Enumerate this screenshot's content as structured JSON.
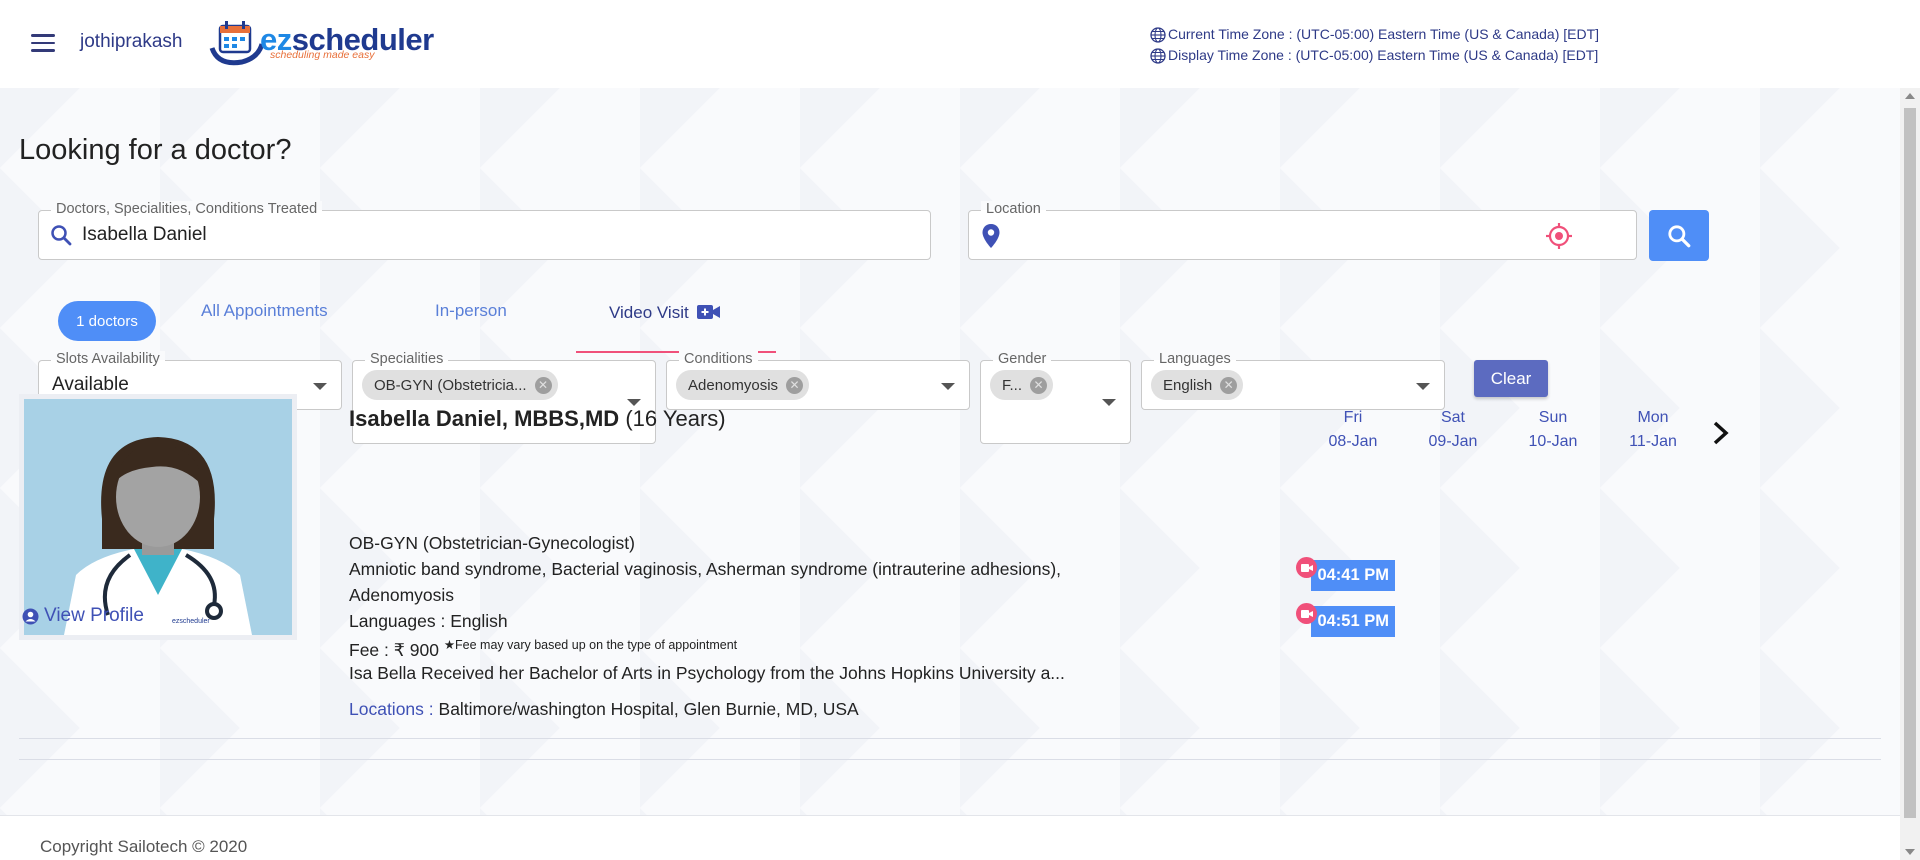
{
  "header": {
    "username": "jothiprakash",
    "logo_main": "ezscheduler",
    "logo_tagline": "scheduling made easy",
    "current_tz": "Current Time Zone : (UTC-05:00) Eastern Time (US & Canada) [EDT]",
    "display_tz": "Display Time Zone : (UTC-05:00) Eastern Time (US & Canada) [EDT]"
  },
  "page": {
    "title": "Looking for a doctor?"
  },
  "search": {
    "query_label": "Doctors, Specialities, Conditions Treated",
    "query_value": "Isabella Daniel",
    "location_label": "Location",
    "location_value": ""
  },
  "tabs": {
    "count": "1 doctors",
    "all": "All Appointments",
    "inperson": "In-person",
    "video": "Video Visit",
    "active": "video"
  },
  "filters": {
    "slots": {
      "label": "Slots Availability",
      "value": "Available"
    },
    "specialities": {
      "label": "Specialities",
      "chip": "OB-GYN (Obstetricia..."
    },
    "conditions": {
      "label": "Conditions",
      "chip": "Adenomyosis"
    },
    "gender": {
      "label": "Gender",
      "chip": "F..."
    },
    "languages": {
      "label": "Languages",
      "chip": "English"
    },
    "clear": "Clear"
  },
  "doctor": {
    "name": "Isabella Daniel, MBBS,MD",
    "experience": "(16 Years)",
    "speciality": "OB-GYN (Obstetrician-Gynecologist)",
    "conditions_line1": "Amniotic band syndrome, Bacterial vaginosis, Asherman syndrome (intrauterine adhesions),",
    "conditions_line2": "Adenomyosis",
    "languages": "Languages : English",
    "fee": "Fee : ₹ 900",
    "fee_note": "★Fee may vary based up on the type of appointment",
    "bio": "Isa Bella Received her Bachelor of Arts in Psychology from the Johns Hopkins University a...",
    "locations_label": "Locations :",
    "locations_value": "Baltimore/washington Hospital, Glen Burnie, MD, USA",
    "view_profile": "View Profile",
    "photo_watermark": "ezscheduler",
    "photo_colors": {
      "background": "#a8d1e6",
      "hair": "#3a2a1e",
      "coat": "#ffffff",
      "scrubs": "#3fb3c9"
    }
  },
  "calendar": {
    "days": [
      {
        "name": "Fri",
        "date": "08-Jan"
      },
      {
        "name": "Sat",
        "date": "09-Jan"
      },
      {
        "name": "Sun",
        "date": "10-Jan"
      },
      {
        "name": "Mon",
        "date": "11-Jan"
      }
    ],
    "slots": [
      {
        "time": "04:41 PM",
        "type": "video"
      },
      {
        "time": "04:51 PM",
        "type": "video"
      }
    ]
  },
  "footer": {
    "copyright": "Copyright Sailotech © 2020"
  },
  "colors": {
    "primary": "#4f8ef7",
    "indigo": "#3f51b5",
    "accent_pink": "#f0507a",
    "clear_button": "#5c6bc0",
    "logo_orange": "#e8703a"
  }
}
